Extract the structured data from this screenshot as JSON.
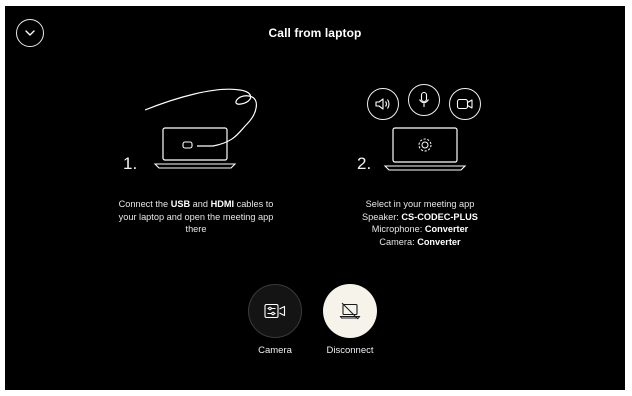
{
  "header": {
    "title": "Call from laptop",
    "collapse_icon": "chevron-down-icon"
  },
  "steps": [
    {
      "number": "1.",
      "illustration": "laptop-with-usb-cable",
      "text_parts": [
        "Connect the ",
        "USB",
        " and ",
        "HDMI",
        " cables to",
        "your laptop and open the meeting app",
        "there"
      ]
    },
    {
      "number": "2.",
      "illustration": "laptop-with-settings-gear",
      "icons": [
        "speaker-icon",
        "microphone-icon",
        "camera-icon"
      ],
      "line1": "Select in your meeting app",
      "speaker_label": "Speaker: ",
      "speaker_value": "CS-CODEC-PLUS",
      "microphone_label": "Microphone: ",
      "microphone_value": "Converter",
      "camera_label": "Camera: ",
      "camera_value": "Converter"
    }
  ],
  "actions": {
    "camera": {
      "label": "Camera",
      "icon": "camera-settings-icon"
    },
    "disconnect": {
      "label": "Disconnect",
      "icon": "laptop-disconnect-icon"
    }
  },
  "colors": {
    "background": "#000000",
    "text": "#ffffff",
    "disconnect_button": "#f5f3ea",
    "camera_button": "#141414"
  }
}
